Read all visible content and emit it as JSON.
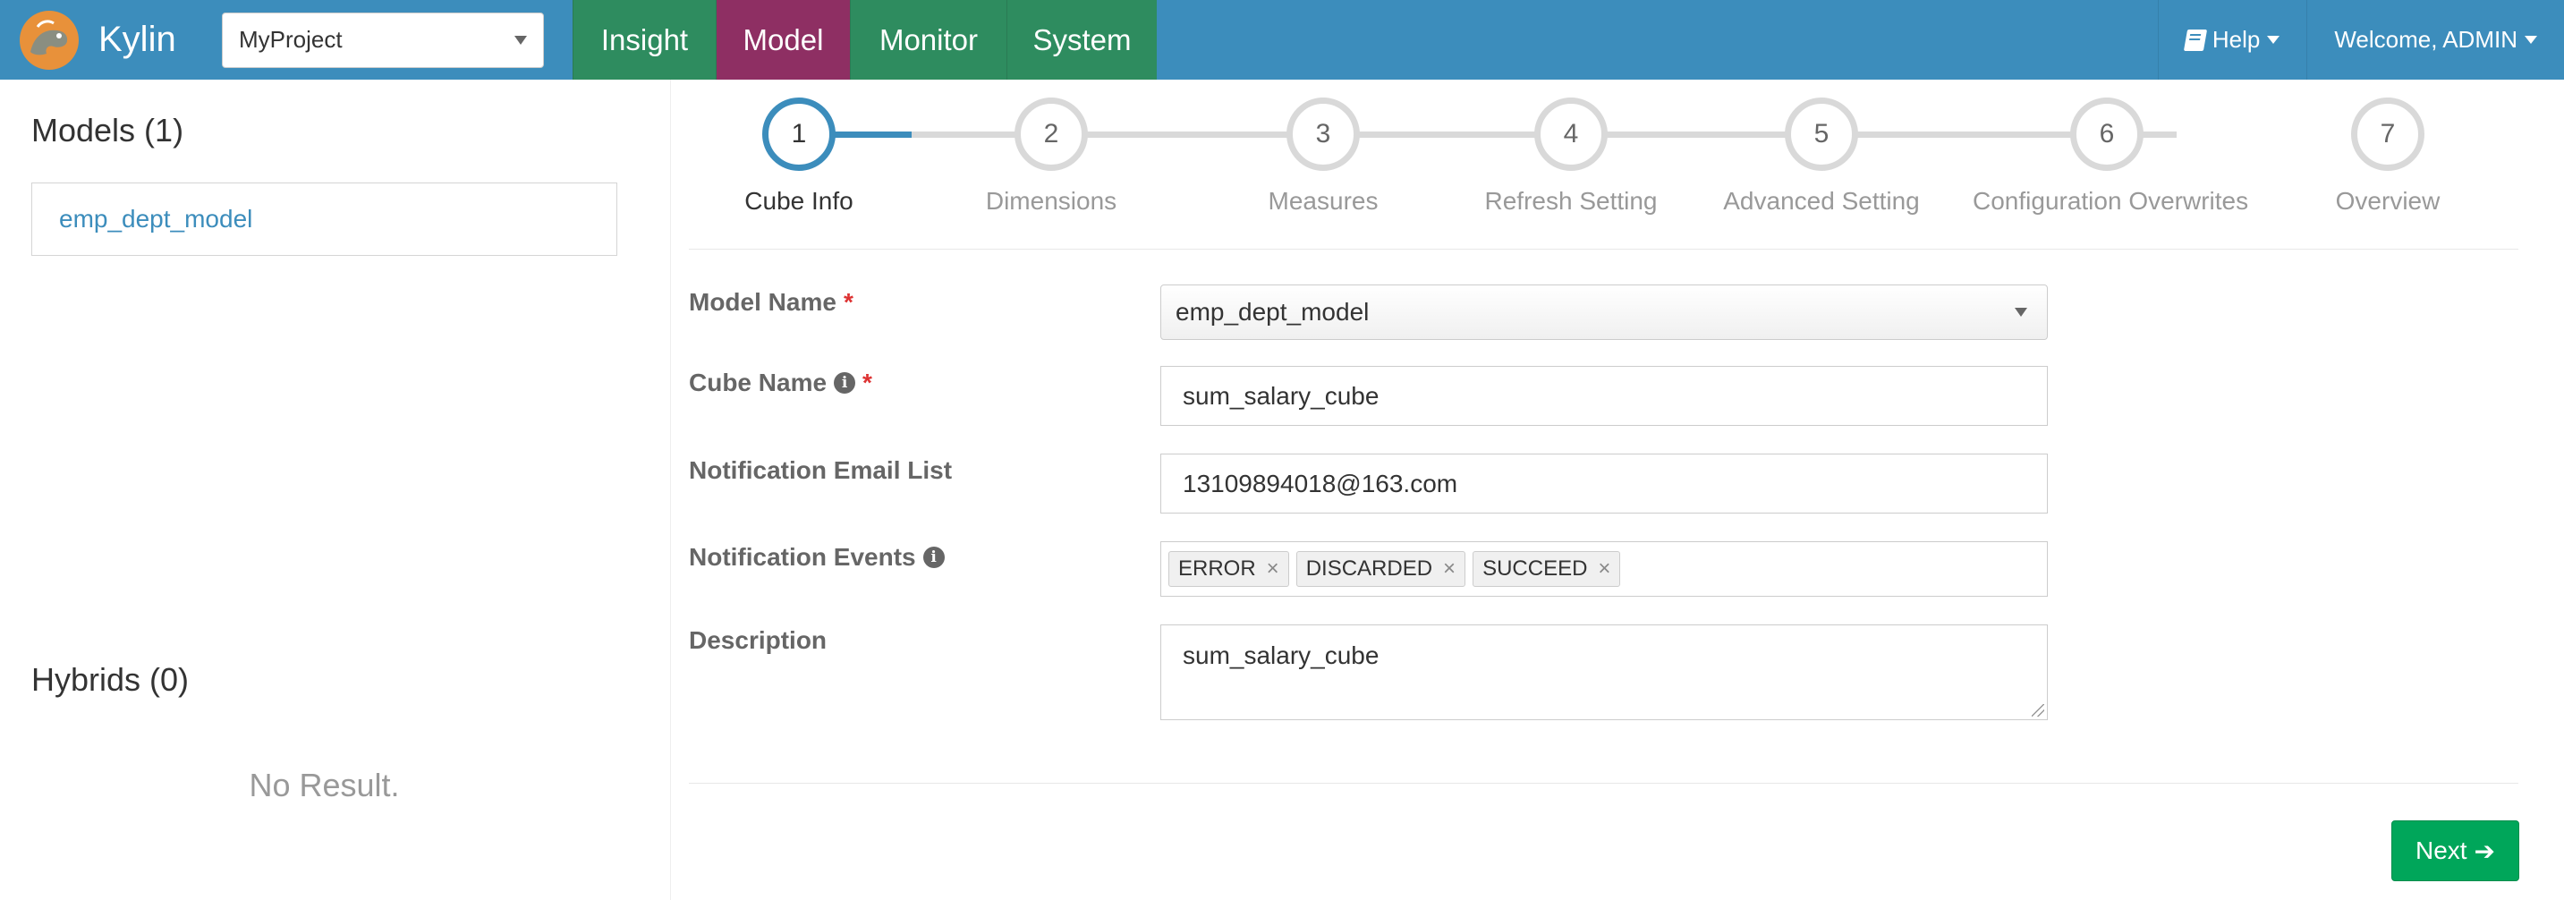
{
  "app": {
    "name": "Kylin"
  },
  "project_select": {
    "value": "MyProject"
  },
  "nav": {
    "insight": "Insight",
    "model": "Model",
    "monitor": "Monitor",
    "system": "System"
  },
  "topbar_right": {
    "help": "Help",
    "welcome": "Welcome, ADMIN"
  },
  "sidebar": {
    "models_title": "Models (1)",
    "models": [
      "emp_dept_model"
    ],
    "hybrids_title": "Hybrids (0)",
    "no_result": "No Result."
  },
  "steps": [
    {
      "num": "1",
      "label": "Cube Info",
      "active": true
    },
    {
      "num": "2",
      "label": "Dimensions"
    },
    {
      "num": "3",
      "label": "Measures"
    },
    {
      "num": "4",
      "label": "Refresh Setting"
    },
    {
      "num": "5",
      "label": "Advanced Setting"
    },
    {
      "num": "6",
      "label": "Configuration Overwrites"
    },
    {
      "num": "7",
      "label": "Overview"
    }
  ],
  "form": {
    "model_name_label": "Model Name",
    "model_name_value": "emp_dept_model",
    "cube_name_label": "Cube Name",
    "cube_name_value": "sum_salary_cube",
    "email_label": "Notification Email List",
    "email_value": "13109894018@163.com",
    "events_label": "Notification Events",
    "events": [
      "ERROR",
      "DISCARDED",
      "SUCCEED"
    ],
    "description_label": "Description",
    "description_value": "sum_salary_cube",
    "required_mark": "*",
    "info_glyph": "i",
    "remove_glyph": "×"
  },
  "next_button": {
    "label": "Next",
    "icon": "arrow-right-icon",
    "glyph": "➔"
  },
  "colors": {
    "topbar": "#3c8dbc",
    "nav": "#2e8c5f",
    "nav_active": "#8e2f63",
    "accent": "#3c8dbc",
    "success": "#00a65a"
  }
}
